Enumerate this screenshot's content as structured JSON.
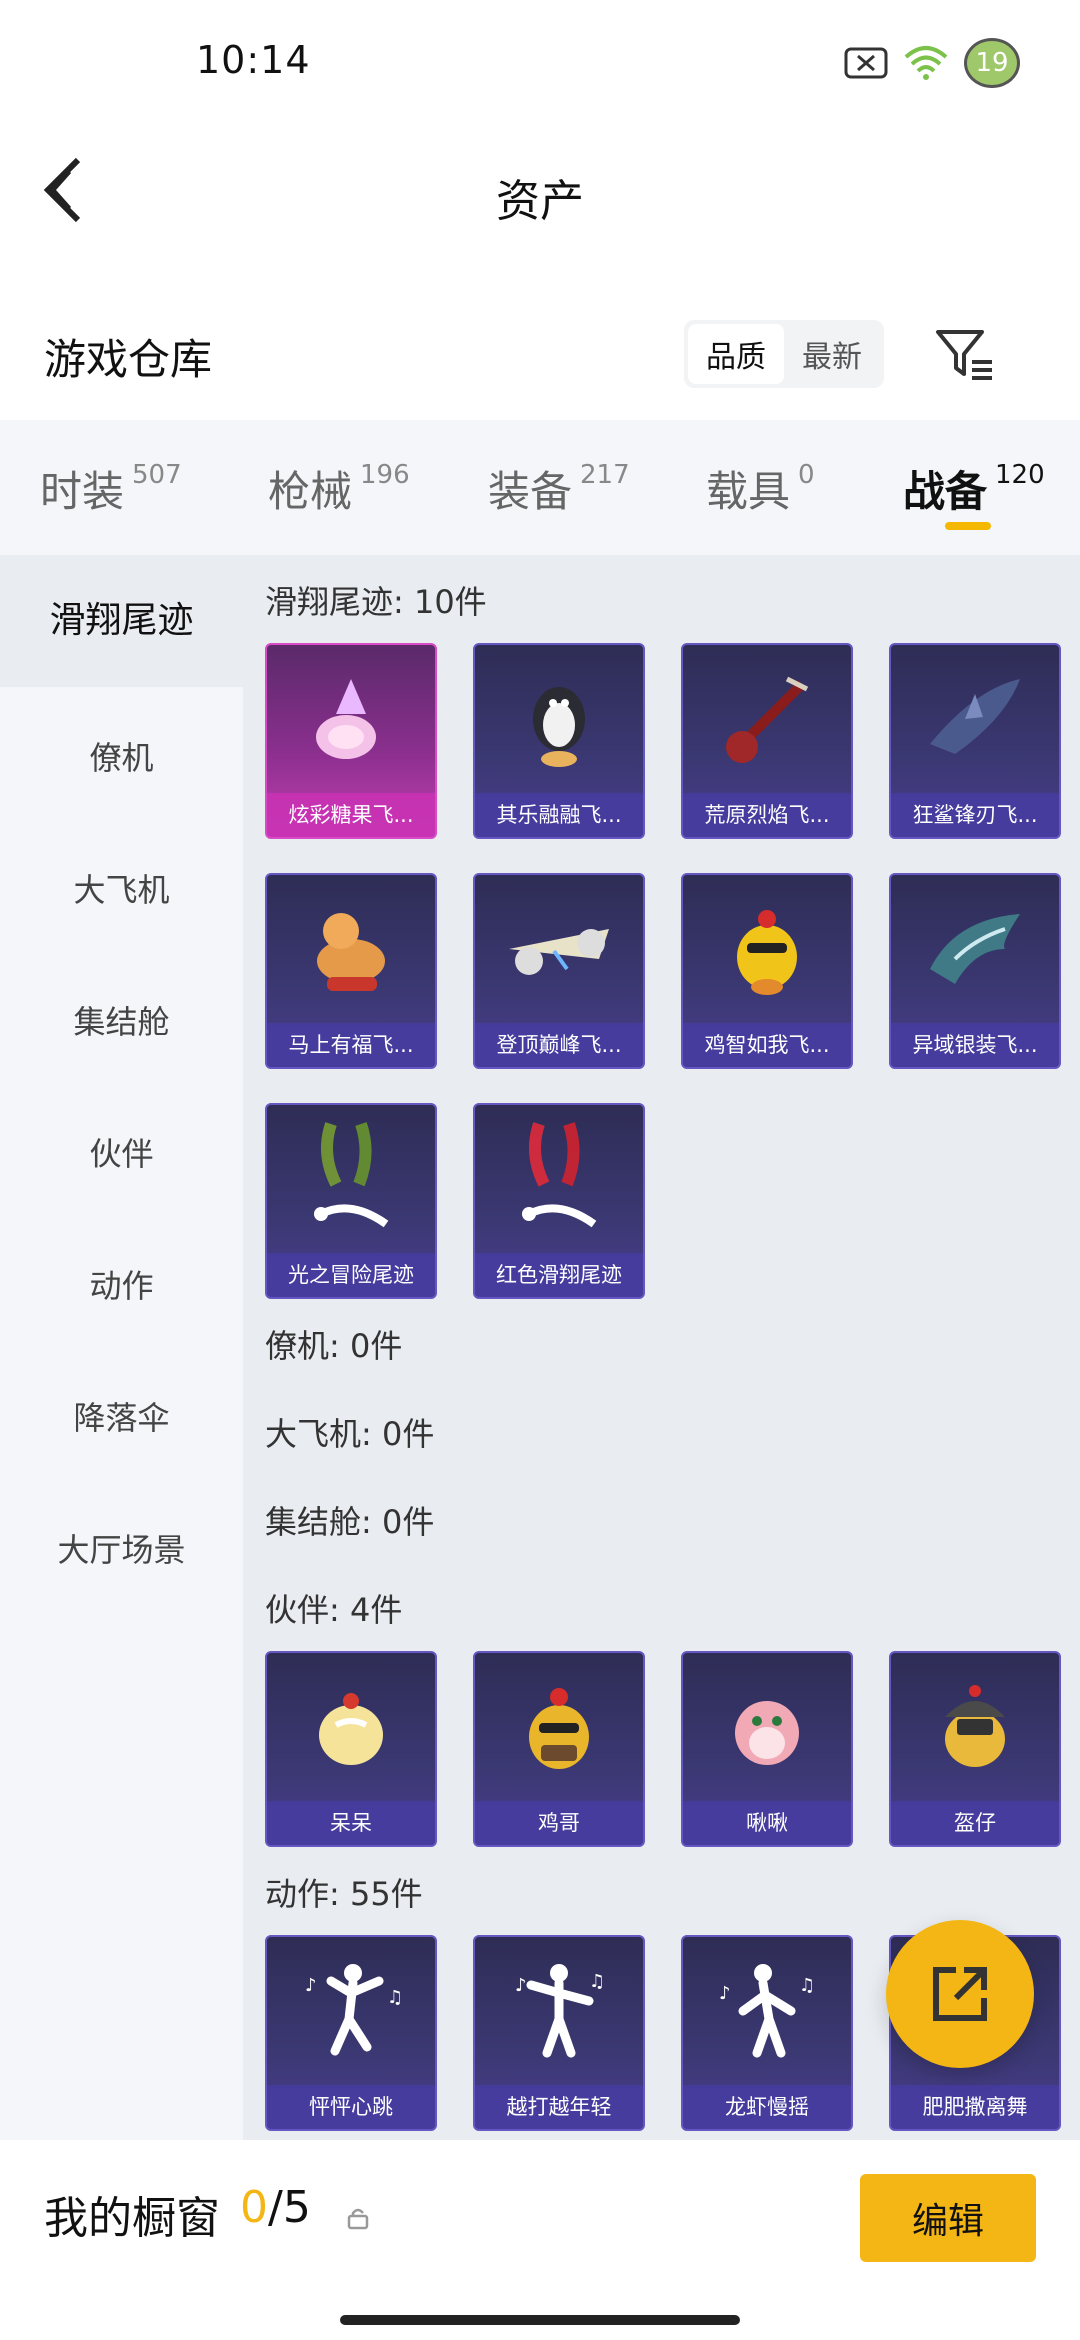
{
  "status": {
    "time": "10:14",
    "battery": "19"
  },
  "nav": {
    "title": "资产"
  },
  "header": {
    "title": "游戏仓库",
    "sort_quality": "品质",
    "sort_newest": "最新"
  },
  "tabs": [
    {
      "label": "时装",
      "count": "507"
    },
    {
      "label": "枪械",
      "count": "196"
    },
    {
      "label": "装备",
      "count": "217"
    },
    {
      "label": "载具",
      "count": "0"
    },
    {
      "label": "战备",
      "count": "120",
      "active": true
    }
  ],
  "sidebar": {
    "items": [
      "滑翔尾迹",
      "僚机",
      "大飞机",
      "集结舱",
      "伙伴",
      "动作",
      "降落伞",
      "大厅场景"
    ]
  },
  "sections": {
    "glide": {
      "title": "滑翔尾迹: 10件",
      "items": [
        "炫彩糖果飞...",
        "其乐融融飞...",
        "荒原烈焰飞...",
        "狂鲨锋刃飞...",
        "马上有福飞...",
        "登顶巅峰飞...",
        "鸡智如我飞...",
        "异域银装飞...",
        "光之冒险尾迹",
        "红色滑翔尾迹"
      ]
    },
    "wingman": {
      "title": "僚机: 0件"
    },
    "plane": {
      "title": "大飞机: 0件"
    },
    "capsule": {
      "title": "集结舱: 0件"
    },
    "partner": {
      "title": "伙伴: 4件",
      "items": [
        "呆呆",
        "鸡哥",
        "啾啾",
        "盔仔"
      ]
    },
    "emote": {
      "title": "动作: 55件",
      "items": [
        "怦怦心跳",
        "越打越年轻",
        "龙虾慢摇",
        "肥肥撒离舞"
      ]
    }
  },
  "bottom": {
    "label": "我的橱窗",
    "current": "0",
    "total": "/5",
    "edit": "编辑"
  },
  "colors": {
    "accent": "#f4b614",
    "card": "#3b3873",
    "card_highlight": "#c43fb0"
  }
}
